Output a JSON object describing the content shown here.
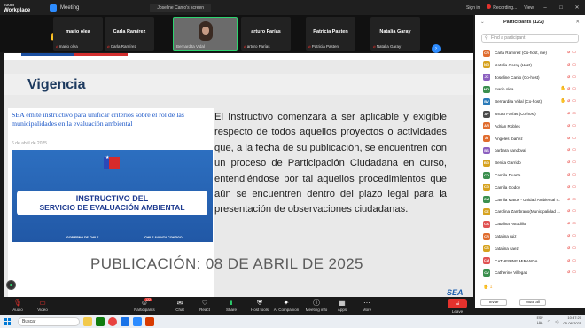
{
  "app": {
    "logo_top": "zoom",
    "logo_bottom": "Workplace",
    "meeting_label": "Meeting",
    "screen_tab": "Joseline Canio's screen",
    "signin": "Sign in",
    "recording": "Recording...",
    "view": "View"
  },
  "strip": {
    "tiles": [
      {
        "big": "mario olea",
        "small": "mario olea"
      },
      {
        "big": "Carla Ramírez",
        "small": "Carla Ramírez"
      },
      {
        "big": "",
        "small": "Bernardita Vidal"
      },
      {
        "big": "arturo Farías",
        "small": "arturo Farías"
      },
      {
        "big": "Patricia Pasten",
        "small": "Patricia Pasten"
      },
      {
        "big": "Natalia Garay",
        "small": "Natalia Garay"
      }
    ],
    "next": "›"
  },
  "slide": {
    "heading": "Vigencia",
    "article_title": "SEA emite instructivo para unificar criterios sobre el rol de las municipalidades en la evaluación ambiental",
    "article_date": "6 de abril de 2025",
    "image_line1": "INSTRUCTIVO DEL",
    "image_line2": "SERVICIO DE EVALUACIÓN AMBIENTAL",
    "image_bar": "",
    "image_gob": "GOBIERNO DE CHILE",
    "image_motto": "CHILE AVANZA CONTIGO",
    "body": "El Instructivo comenzará a ser aplicable y exigible respecto de todos aquellos proyectos o actividades que, a la fecha de su publicación, se encuentren con un proceso de Participación Ciudadana en curso, entendiéndose por tal aquellos procedimientos que aún se encuentren dentro del plazo legal para la presentación de observaciones ciudadanas.",
    "publication": "PUBLICACIÓN: 08 DE ABRIL DE 2025",
    "footer_logo": "SEA"
  },
  "panel": {
    "title": "Participants (122)",
    "search_placeholder": "Find a participant",
    "participants": [
      {
        "name": "Carla Ramírez (Co-host, me)",
        "color": "#e06c2e",
        "initial": "CR"
      },
      {
        "name": "Natalia Garay (Host)",
        "color": "#d6a21e",
        "initial": "NG"
      },
      {
        "name": "Joseline Canio (Co-host)",
        "color": "#8b5fbf",
        "initial": "JC"
      },
      {
        "name": "mario olea",
        "color": "#3b8f4e",
        "initial": "MO"
      },
      {
        "name": "Bernardita Vidal (Co-host)",
        "color": "#2a7ab8",
        "initial": "BV"
      },
      {
        "name": "arturo Farías (Co-host)",
        "color": "#4a4a4a",
        "initial": "AF"
      },
      {
        "name": "Adrian Robles",
        "color": "#e06c2e",
        "initial": "AR"
      },
      {
        "name": "Ángeles Ibañez",
        "color": "#e06c2e",
        "initial": "ÁI"
      },
      {
        "name": "barbara sandoval",
        "color": "#8b5fbf",
        "initial": "BS"
      },
      {
        "name": "Benita Garrido",
        "color": "#d6a21e",
        "initial": "BG"
      },
      {
        "name": "Camila Duarte",
        "color": "#3b8f4e",
        "initial": "CD"
      },
      {
        "name": "Camila Godoy",
        "color": "#d6a21e",
        "initial": "CG"
      },
      {
        "name": "Camila Matus - Unidad Ambiental I...",
        "color": "#3b8f4e",
        "initial": "CM"
      },
      {
        "name": "Carolina Zambrano(Municipalidad ...",
        "color": "#d6a21e",
        "initial": "CZ"
      },
      {
        "name": "Catalina Astudillo",
        "color": "#e05252",
        "initial": "CA"
      },
      {
        "name": "catalina ruiz",
        "color": "#e06c2e",
        "initial": "CR"
      },
      {
        "name": "catalina saez",
        "color": "#d6a21e",
        "initial": "CS"
      },
      {
        "name": "CATHERINE MIRANDA",
        "color": "#e05252",
        "initial": "CM"
      },
      {
        "name": "Catherine Villegas",
        "color": "#3b8f4e",
        "initial": "CV"
      }
    ],
    "reaction_count": "1",
    "invite": "Invite",
    "mute_all": "Mute all",
    "more": "···"
  },
  "toolbar": {
    "audio": "Audio",
    "video": "Video",
    "participants": "Participants",
    "participants_count": "122",
    "chat": "Chat",
    "react": "React",
    "share": "Share",
    "host_tools": "Host tools",
    "ai_companion": "AI Companion",
    "meeting_info": "Meeting info",
    "apps": "Apps",
    "more": "More",
    "leave": "Leave"
  },
  "taskbar": {
    "search": "Buscar",
    "lang_top": "ESP",
    "lang_bottom": "LAA",
    "time": "10:37:20",
    "date": "05-08-2025"
  }
}
